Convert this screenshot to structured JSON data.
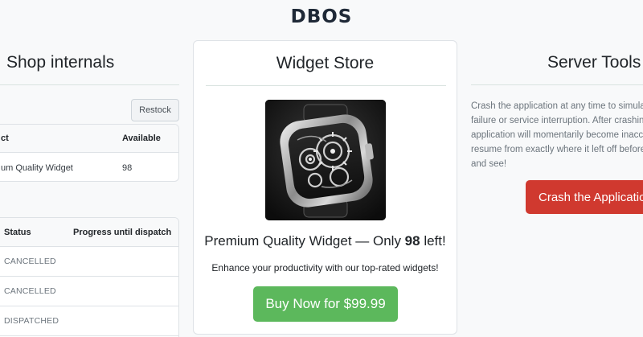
{
  "header": {
    "logo_text": "DBOS"
  },
  "shop_internals": {
    "title": "Shop internals",
    "restock_label": "Restock",
    "inventory": {
      "columns": [
        "ct",
        "Available"
      ],
      "rows": [
        {
          "product": "um Quality Widget",
          "available": "98"
        }
      ]
    },
    "orders": {
      "columns": [
        "Status",
        "Progress until dispatch"
      ],
      "rows": [
        {
          "status": "CANCELLED"
        },
        {
          "status": "CANCELLED"
        },
        {
          "status": "DISPATCHED"
        }
      ]
    }
  },
  "store": {
    "title": "Widget Store",
    "product_prefix": "Premium Quality Widget — Only ",
    "stock_count": "98",
    "product_suffix": " left!",
    "tagline": "Enhance your productivity with our top-rated widgets!",
    "buy_label": "Buy Now for $99.99",
    "image_icon": "smartwatch-gears-image"
  },
  "server_tools": {
    "title": "Server Tools",
    "description_lines": [
      "Crash the application at any time to simula",
      "failure or service interruption. After crashin",
      "application will momentarily become inacc",
      "resume from exactly where it left off before",
      "and see!"
    ],
    "crash_label": "Crash the Application"
  },
  "colors": {
    "buy_button": "#5cb85c",
    "crash_button": "#d0392f",
    "divider": "#d9e3df"
  }
}
